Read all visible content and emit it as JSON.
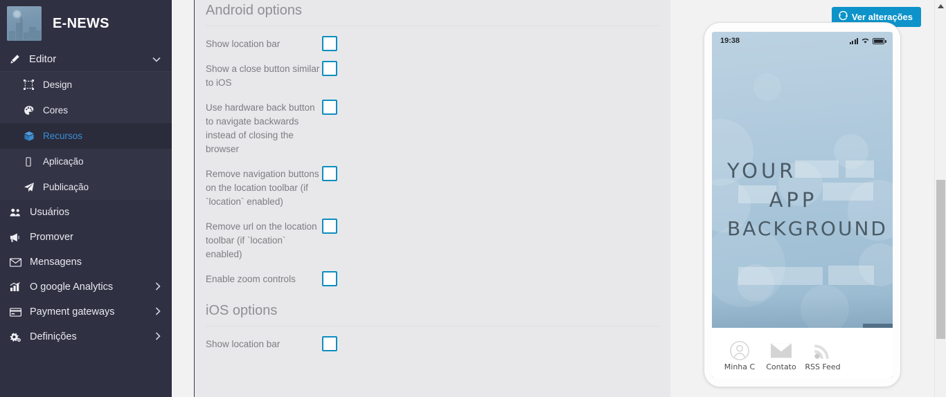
{
  "sidebar": {
    "brand": {
      "title": "E-NEWS",
      "logo_icon": "city-skyline-logo"
    },
    "group": {
      "label": "Editor",
      "icon": "pencil-icon",
      "caret_icon": "chevron-down-icon",
      "caret_glyph": "⌄",
      "items": [
        {
          "label": "Design",
          "icon": "design-frame-icon",
          "glyph": "⛶",
          "active": false
        },
        {
          "label": "Cores",
          "icon": "palette-icon",
          "glyph": "◑",
          "active": false
        },
        {
          "label": "Recursos",
          "icon": "cube-box-icon",
          "glyph": "⬟",
          "active": true
        },
        {
          "label": "Aplicação",
          "icon": "mobile-phone-icon",
          "glyph": "▯",
          "active": false
        },
        {
          "label": "Publicação",
          "icon": "paper-plane-icon",
          "glyph": "➤",
          "active": false
        }
      ]
    },
    "items": [
      {
        "label": "Usuários",
        "icon": "users-icon",
        "chevron": false
      },
      {
        "label": "Promover",
        "icon": "megaphone-icon",
        "chevron": false
      },
      {
        "label": "Mensagens",
        "icon": "envelope-icon",
        "chevron": false
      },
      {
        "label": "O google Analytics",
        "icon": "bar-chart-icon",
        "chevron": true
      },
      {
        "label": "Payment gateways",
        "icon": "credit-card-icon",
        "chevron": true
      },
      {
        "label": "Definições",
        "icon": "gears-icon",
        "chevron": true
      }
    ],
    "chevron_glyph": "›"
  },
  "content": {
    "sections": [
      {
        "title": "Android options",
        "options": [
          {
            "label": "Show location bar",
            "checked": false
          },
          {
            "label": "Show a close button similar to iOS",
            "checked": false
          },
          {
            "label": "Use hardware back button to navigate backwards instead of closing the browser",
            "checked": false
          },
          {
            "label": "Remove navigation buttons on the location toolbar (if `location` enabled)",
            "checked": false
          },
          {
            "label": "Remove url on the location toolbar (if `location` enabled)",
            "checked": false
          },
          {
            "label": "Enable zoom controls",
            "checked": false
          }
        ]
      },
      {
        "title": "iOS options",
        "options": [
          {
            "label": "Show location bar",
            "checked": false
          }
        ]
      }
    ]
  },
  "preview": {
    "refresh_button": {
      "label": "Ver alterações",
      "icon": "refresh-icon",
      "glyph": "↻",
      "color": "#0d93c9"
    },
    "phone": {
      "status_bar": {
        "time": "19:38",
        "signal_icon": "signal-bars-icon",
        "wifi_icon": "wifi-icon",
        "battery_icon": "battery-icon"
      },
      "hero_lines": [
        "YOUR",
        "APP",
        "BACKGROUND"
      ],
      "tabs": [
        {
          "label": "Minha C",
          "icon": "account-person-icon"
        },
        {
          "label": "Contato",
          "icon": "envelope-icon"
        },
        {
          "label": "RSS Feed",
          "icon": "rss-feed-icon"
        }
      ]
    }
  },
  "scrollbar": {
    "up_arrow_icon": "triangle-up-icon",
    "up_glyph": "▲"
  },
  "colors": {
    "accent": "#0d8dc0",
    "sidebar_bg": "#2f3042",
    "panel_bg": "#e8e8ea",
    "active_link": "#3a8fd6"
  }
}
